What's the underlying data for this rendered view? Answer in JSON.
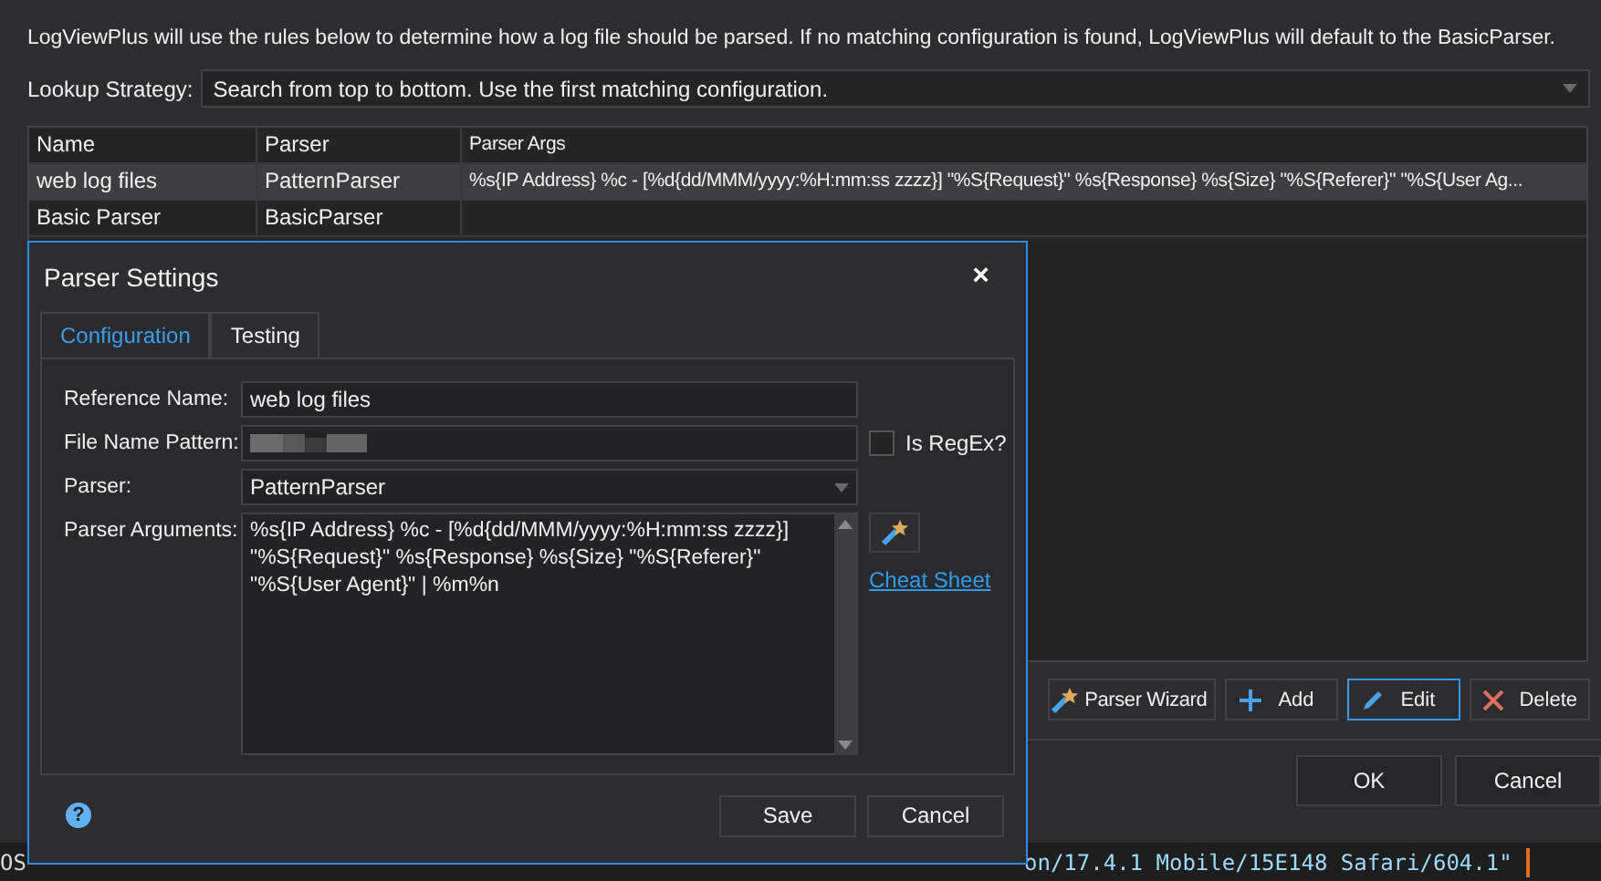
{
  "intro": "LogViewPlus will use the rules below to determine how a log file should be parsed.  If no matching configuration is found, LogViewPlus will default to the BasicParser.",
  "lookup_strategy": {
    "label": "Lookup Strategy:",
    "value": "Search from top to bottom.  Use the first matching configuration."
  },
  "table": {
    "columns": [
      "Name",
      "Parser",
      "Parser Args"
    ],
    "rows": [
      {
        "cells": [
          "web log files",
          "PatternParser",
          "%s{IP Address} %c - [%d{dd/MMM/yyyy:%H:mm:ss zzzz}] \"%S{Request}\" %s{Response} %s{Size} \"%S{Referer}\" \"%S{User Ag..."
        ],
        "selected": true
      },
      {
        "cells": [
          "Basic Parser",
          "BasicParser"
        ],
        "selected": false
      }
    ]
  },
  "list_buttons": [
    {
      "kind": "wand",
      "label": "Parser Wizard",
      "focused": false
    },
    {
      "kind": "add",
      "label": "Add",
      "focused": false
    },
    {
      "kind": "edit",
      "label": "Edit",
      "focused": true
    },
    {
      "kind": "delete",
      "label": "Delete",
      "focused": false
    }
  ],
  "window_buttons": [
    "OK",
    "Cancel"
  ],
  "background_log": {
    "left": "OS",
    "right": "on/17.4.1 Mobile/15E148 Safari/604.1\""
  },
  "dialog": {
    "title": "Parser Settings",
    "close": "×",
    "tabs": [
      {
        "label": "Configuration",
        "selected": true
      },
      {
        "label": "Testing",
        "selected": false
      }
    ],
    "fields": [
      {
        "kind": "text",
        "label": "Reference Name:",
        "value": "web log files"
      },
      {
        "kind": "redacted",
        "label": "File Name Pattern:",
        "checkbox": {
          "label": "Is RegEx?",
          "checked": false
        }
      },
      {
        "kind": "select",
        "label": "Parser:",
        "value": "PatternParser"
      },
      {
        "kind": "multiline",
        "label": "Parser Arguments:",
        "value": "%s{IP Address} %c - [%d{dd/MMM/yyyy:%H:mm:ss zzzz}] \"%S{Request}\" %s{Response} %s{Size} \"%S{Referer}\" \"%S{User Agent}\" | %m%n",
        "link": "Cheat Sheet"
      }
    ],
    "help": "?",
    "buttons": [
      "Save",
      "Cancel"
    ]
  }
}
